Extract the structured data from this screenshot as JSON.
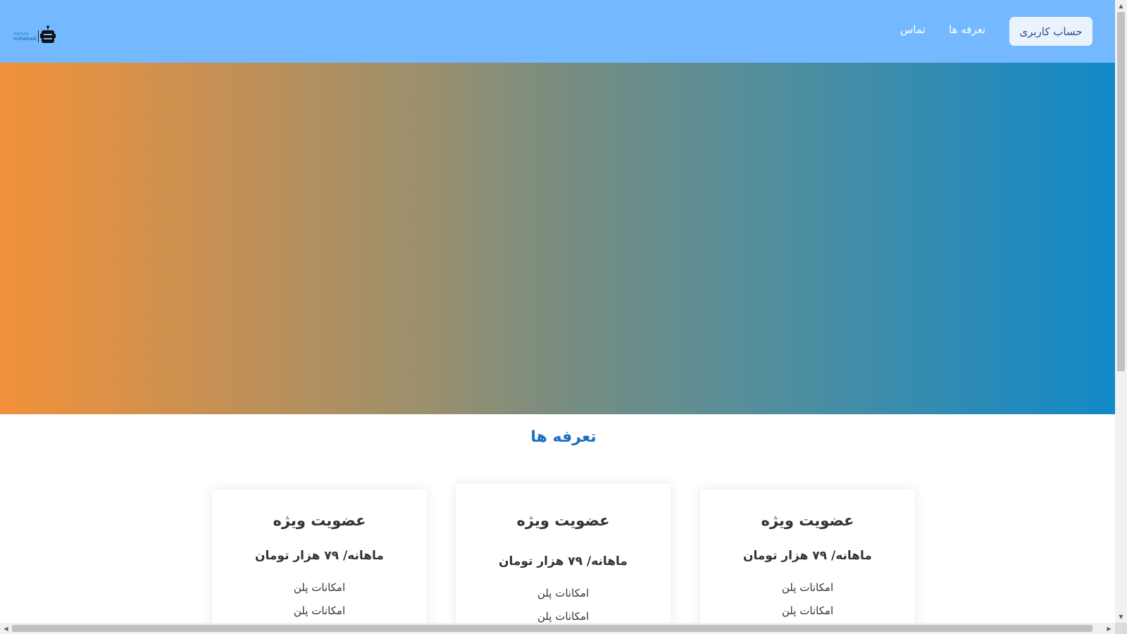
{
  "nav": {
    "logo_line1": "Alireza",
    "logo_line2": "mohamadi",
    "account_button": "حساب کاربری",
    "link_tariffs": "تعرفه ها",
    "link_contact": "تماس"
  },
  "hero": {
    "gradient_start": "#f2913a",
    "gradient_end": "#1289c8"
  },
  "pricing": {
    "title": "تعرفه ها",
    "cards": [
      {
        "title": "عضویت ویژه",
        "price": "ماهانه/ ۷۹ هزار تومان",
        "features": [
          "امکانات پلن",
          "امکانات پلن"
        ]
      },
      {
        "title": "عضویت ویژه",
        "price": "ماهانه/ ۷۹ هزار تومان",
        "features": [
          "امکانات پلن",
          "امکانات پلن"
        ]
      },
      {
        "title": "عضویت ویژه",
        "price": "ماهانه/ ۷۹ هزار تومان",
        "features": [
          "امکانات پلن",
          "امکانات پلن"
        ]
      }
    ]
  },
  "scrollbar": {
    "up_arrow": "▲",
    "down_arrow": "▼",
    "left_arrow": "◀",
    "right_arrow": "▶"
  },
  "colors": {
    "navbar": "#74b9ff",
    "title": "#1a6fc4"
  }
}
